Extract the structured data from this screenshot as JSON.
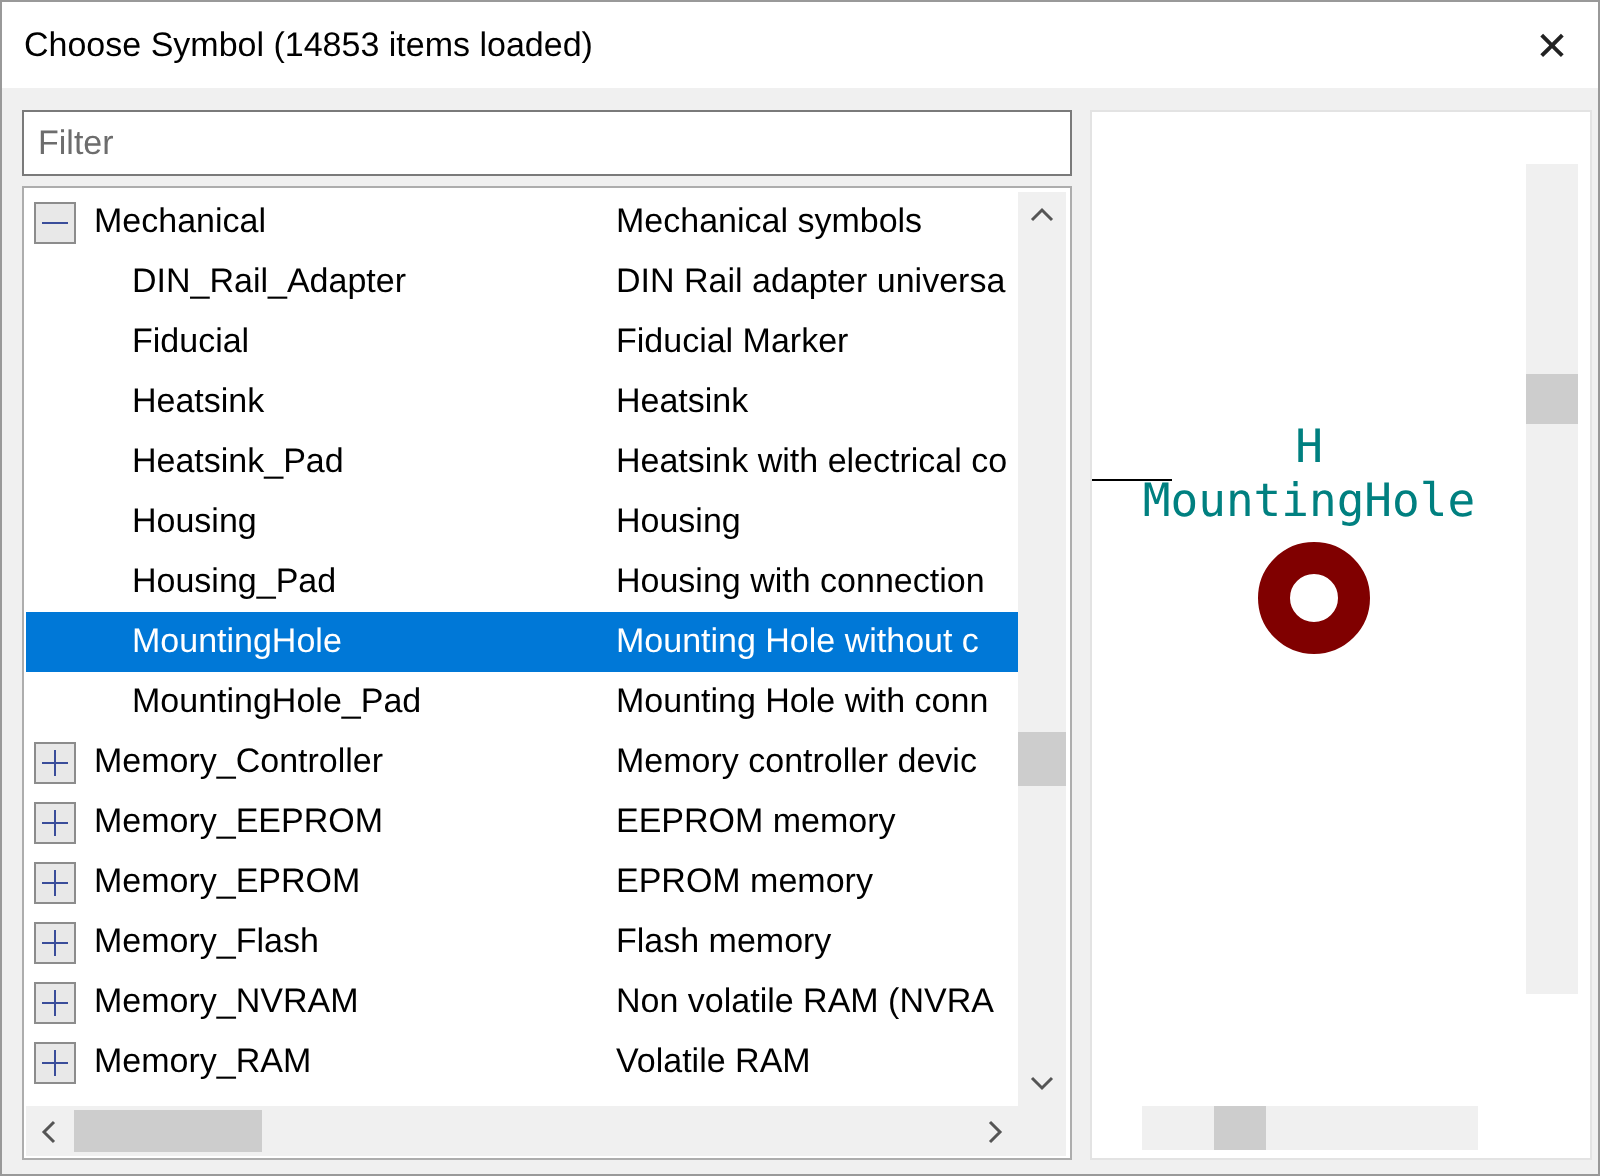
{
  "window": {
    "title": "Choose Symbol (14853 items loaded)",
    "close": "✕"
  },
  "filter": {
    "placeholder": "Filter"
  },
  "tree": [
    {
      "name": "Mechanical",
      "description": "Mechanical symbols",
      "expanded": true,
      "selected": false,
      "children": [
        {
          "name": "DIN_Rail_Adapter",
          "description": "DIN Rail adapter universa",
          "selected": false
        },
        {
          "name": "Fiducial",
          "description": "Fiducial Marker",
          "selected": false
        },
        {
          "name": "Heatsink",
          "description": "Heatsink",
          "selected": false
        },
        {
          "name": "Heatsink_Pad",
          "description": "Heatsink with electrical co",
          "selected": false
        },
        {
          "name": "Housing",
          "description": "Housing",
          "selected": false
        },
        {
          "name": "Housing_Pad",
          "description": "Housing with connection",
          "selected": false
        },
        {
          "name": "MountingHole",
          "description": "Mounting Hole without c",
          "selected": true
        },
        {
          "name": "MountingHole_Pad",
          "description": "Mounting Hole with conn",
          "selected": false
        }
      ]
    },
    {
      "name": "Memory_Controller",
      "description": "Memory controller devic",
      "expanded": false,
      "selected": false
    },
    {
      "name": "Memory_EEPROM",
      "description": "EEPROM memory",
      "expanded": false,
      "selected": false
    },
    {
      "name": "Memory_EPROM",
      "description": "EPROM memory",
      "expanded": false,
      "selected": false
    },
    {
      "name": "Memory_Flash",
      "description": "Flash memory",
      "expanded": false,
      "selected": false
    },
    {
      "name": "Memory_NVRAM",
      "description": "Non volatile RAM (NVRA",
      "expanded": false,
      "selected": false
    },
    {
      "name": "Memory_RAM",
      "description": "Volatile RAM",
      "expanded": false,
      "selected": false
    }
  ],
  "preview": {
    "reference": "H",
    "value": "MountingHole"
  }
}
